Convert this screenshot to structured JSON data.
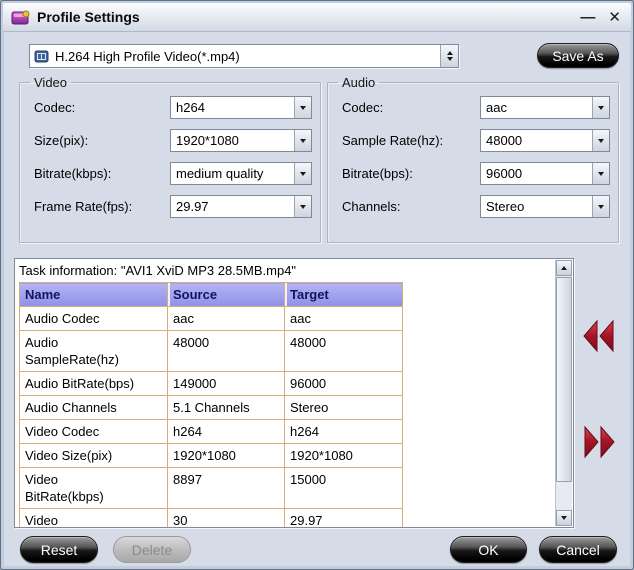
{
  "colors": {
    "dialog_bg": "#d5dce8",
    "table_header_bg": "#9c9cec",
    "table_header_text": "#14145e",
    "table_border": "#d8ae78",
    "nav_arrow_red": "#a31225",
    "button_dark": "#000000"
  },
  "window": {
    "title": "Profile Settings",
    "minimize": "—",
    "close": "✕"
  },
  "profile": {
    "selected": "H.264 High Profile Video(*.mp4)",
    "save_as": "Save As"
  },
  "video": {
    "legend": "Video",
    "fields": [
      {
        "label": "Codec:",
        "value": "h264"
      },
      {
        "label": "Size(pix):",
        "value": "1920*1080"
      },
      {
        "label": "Bitrate(kbps):",
        "value": "medium quality"
      },
      {
        "label": "Frame Rate(fps):",
        "value": "29.97"
      }
    ]
  },
  "audio": {
    "legend": "Audio",
    "fields": [
      {
        "label": "Codec:",
        "value": "aac"
      },
      {
        "label": "Sample Rate(hz):",
        "value": "48000"
      },
      {
        "label": "Bitrate(bps):",
        "value": "96000"
      },
      {
        "label": "Channels:",
        "value": "Stereo"
      }
    ]
  },
  "task": {
    "title": "Task information: \"AVI1 XviD MP3 28.5MB.mp4\"",
    "columns": [
      "Name",
      "Source",
      "Target"
    ],
    "rows": [
      [
        "Audio Codec",
        "aac",
        "aac"
      ],
      [
        "Audio\nSampleRate(hz)",
        "48000",
        "48000"
      ],
      [
        "Audio BitRate(bps)",
        "149000",
        "96000"
      ],
      [
        "Audio Channels",
        "5.1 Channels",
        "Stereo"
      ],
      [
        "Video Codec",
        "h264",
        "h264"
      ],
      [
        "Video Size(pix)",
        "1920*1080",
        "1920*1080"
      ],
      [
        "Video\nBitRate(kbps)",
        "8897",
        "15000"
      ],
      [
        "Video\nFrameRate(fps)",
        "30",
        "29.97"
      ]
    ]
  },
  "footer": {
    "reset": "Reset",
    "delete": "Delete",
    "ok": "OK",
    "cancel": "Cancel"
  }
}
